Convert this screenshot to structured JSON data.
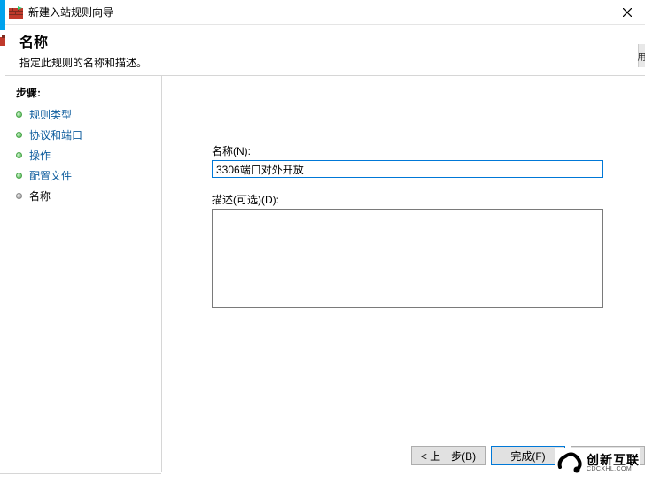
{
  "window": {
    "title": "新建入站规则向导",
    "close_label": "×"
  },
  "header": {
    "heading": "名称",
    "subtitle": "指定此规则的名称和描述。"
  },
  "sidebar": {
    "heading": "步骤:",
    "steps": [
      {
        "label": "规则类型"
      },
      {
        "label": "协议和端口"
      },
      {
        "label": "操作"
      },
      {
        "label": "配置文件"
      },
      {
        "label": "名称"
      }
    ]
  },
  "form": {
    "name_label": "名称(N):",
    "name_value": "3306端口对外开放",
    "desc_label": "描述(可选)(D):",
    "desc_value": ""
  },
  "buttons": {
    "back": "< 上一步(B)",
    "finish": "完成(F)"
  },
  "watermark": {
    "cn": "创新互联",
    "en": "CDCXHL.COM"
  },
  "right_fragment": "用"
}
